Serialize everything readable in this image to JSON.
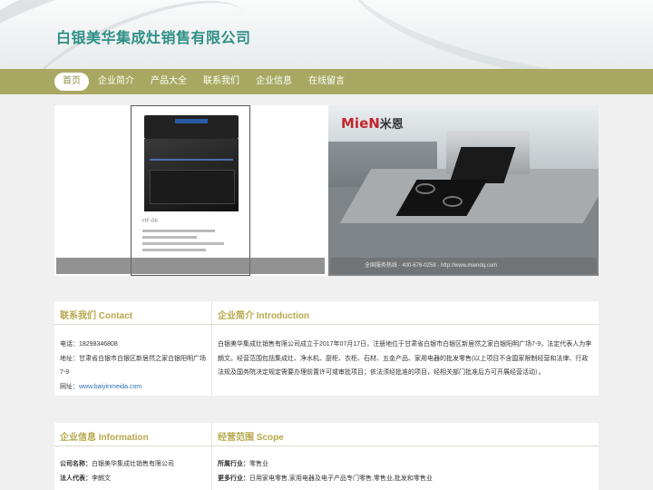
{
  "site": {
    "title": "白银美华集成灶销售有限公司"
  },
  "nav": {
    "items": [
      {
        "label": "首页",
        "active": true
      },
      {
        "label": "企业简介",
        "active": false
      },
      {
        "label": "产品大全",
        "active": false
      },
      {
        "label": "联系我们",
        "active": false
      },
      {
        "label": "企业信息",
        "active": false
      },
      {
        "label": "在线留言",
        "active": false
      }
    ]
  },
  "banner": {
    "slide1": {
      "model_label": "HF-06"
    },
    "slide2": {
      "brand": "MieN",
      "brand_cn": "米恩",
      "hotline": "全国服务热线 · 400-676-0258 · http://www.miendq.com"
    }
  },
  "contact": {
    "title": "联系我们 Contact",
    "phone_label": "电话：",
    "phone": "18298346808",
    "address_label": "地址：",
    "address": "甘肃省白银市白银区新居然之家白银阳明广场7-9",
    "website_label": "网址：",
    "website": "www.baiyinmeida.com"
  },
  "intro": {
    "title": "企业简介 Introduction",
    "text": "白银美华集成灶销售有限公司成立于2017年07月17日，注册地位于甘肃省白银市白银区新居然之家白银阳明广场7-9，法定代表人为李朗文。经营范围包括集成灶、净水机、厨柜、衣柜、石材、五金产品、家用电器的批发零售(以上项目不含国家限制经营和法律、行政法规及国务院决定规定需要办理前置许可或审批项目；依法须经批准的项目，经相关部门批准后方可开展经营活动）。"
  },
  "info": {
    "title": "企业信息 Information",
    "company_label": "公司名称：",
    "company": "白银美华集成灶销售有限公司",
    "legal_label": "法人代表：",
    "legal": "李朗文"
  },
  "scope": {
    "title": "经营范围 Scope",
    "industry_label": "所属行业：",
    "industry": "零售业",
    "more_label": "更多行业：",
    "more": "日用家电零售,家用电器及电子产品专门零售,零售业,批发和零售业"
  }
}
